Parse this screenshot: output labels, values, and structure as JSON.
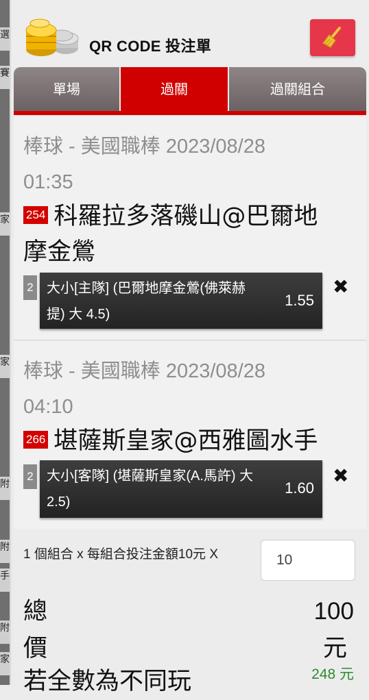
{
  "header": {
    "title": "QR CODE 投注單"
  },
  "tabs": [
    {
      "label": "單場"
    },
    {
      "label": "過關"
    },
    {
      "label": "過關組合"
    }
  ],
  "bets": [
    {
      "header_line1": "棒球 - 美國職棒 2023/08/28",
      "header_line2": "01:35",
      "code": "254",
      "match_line1": "科羅拉多落磯山@巴爾地",
      "match_line2": "摩金鶯",
      "index": "2",
      "desc_line1": "大小[主隊] (巴爾地摩金鶯(佛萊赫",
      "desc_line2": "提) 大 4.5)",
      "odds": "1.55"
    },
    {
      "header_line1": "棒球 - 美國職棒 2023/08/28",
      "header_line2": "04:10",
      "code": "266",
      "match_line1": "堪薩斯皇家@西雅圖水手",
      "index": "2",
      "desc_line1": "大小[客隊] (堪薩斯皇家(A.馬許) 大",
      "desc_line2": "2.5)",
      "odds": "1.60"
    }
  ],
  "footer": {
    "combo_label": "1 個組合 x 每組合投注金額10元 X",
    "amount_value": "10",
    "total_label_1": "總",
    "total_label_2": "價",
    "total_value": "100",
    "total_unit": "元",
    "note": "若全數為不同玩",
    "payout": "248 元"
  },
  "left_strip": [
    "選",
    "賽",
    "家",
    "家",
    "附",
    "附",
    "手",
    "附",
    "家"
  ],
  "icons": {
    "clear": "broom-icon",
    "remove": "close-icon",
    "logo": "coins-icon"
  },
  "colors": {
    "accent": "#d00000",
    "clear_button": "#e5364a",
    "payout": "#2e8b2e"
  }
}
